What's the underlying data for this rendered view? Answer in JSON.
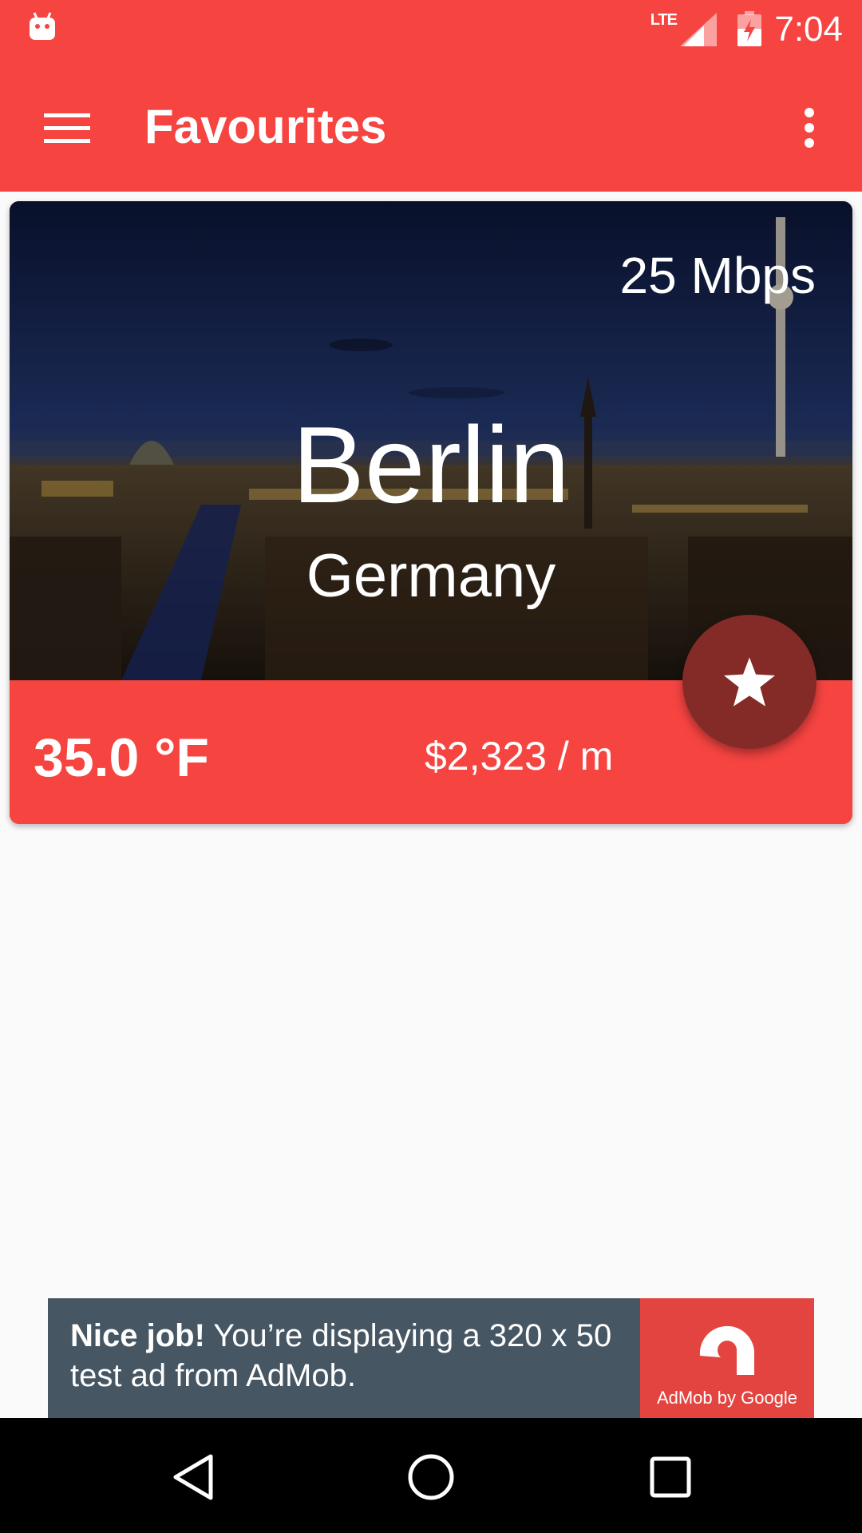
{
  "status_bar": {
    "network": "LTE",
    "time": "7:04"
  },
  "app_bar": {
    "title": "Favourites",
    "menu_icon": "hamburger-menu-icon",
    "overflow_icon": "more-vertical-icon"
  },
  "favourite_card": {
    "speed": "25 Mbps",
    "city": "Berlin",
    "country": "Germany",
    "temperature": "35.0 °F",
    "cost": "$2,323 / m",
    "fab_icon": "star-icon"
  },
  "ad": {
    "headline": "Nice job!",
    "body": " You’re displaying a 320 x 50 test ad from AdMob.",
    "logo_caption": "AdMob by Google"
  },
  "colors": {
    "primary": "#f64441",
    "fab": "#842b28",
    "ad_background": "#465663",
    "ad_logo_background": "#e4443f"
  }
}
